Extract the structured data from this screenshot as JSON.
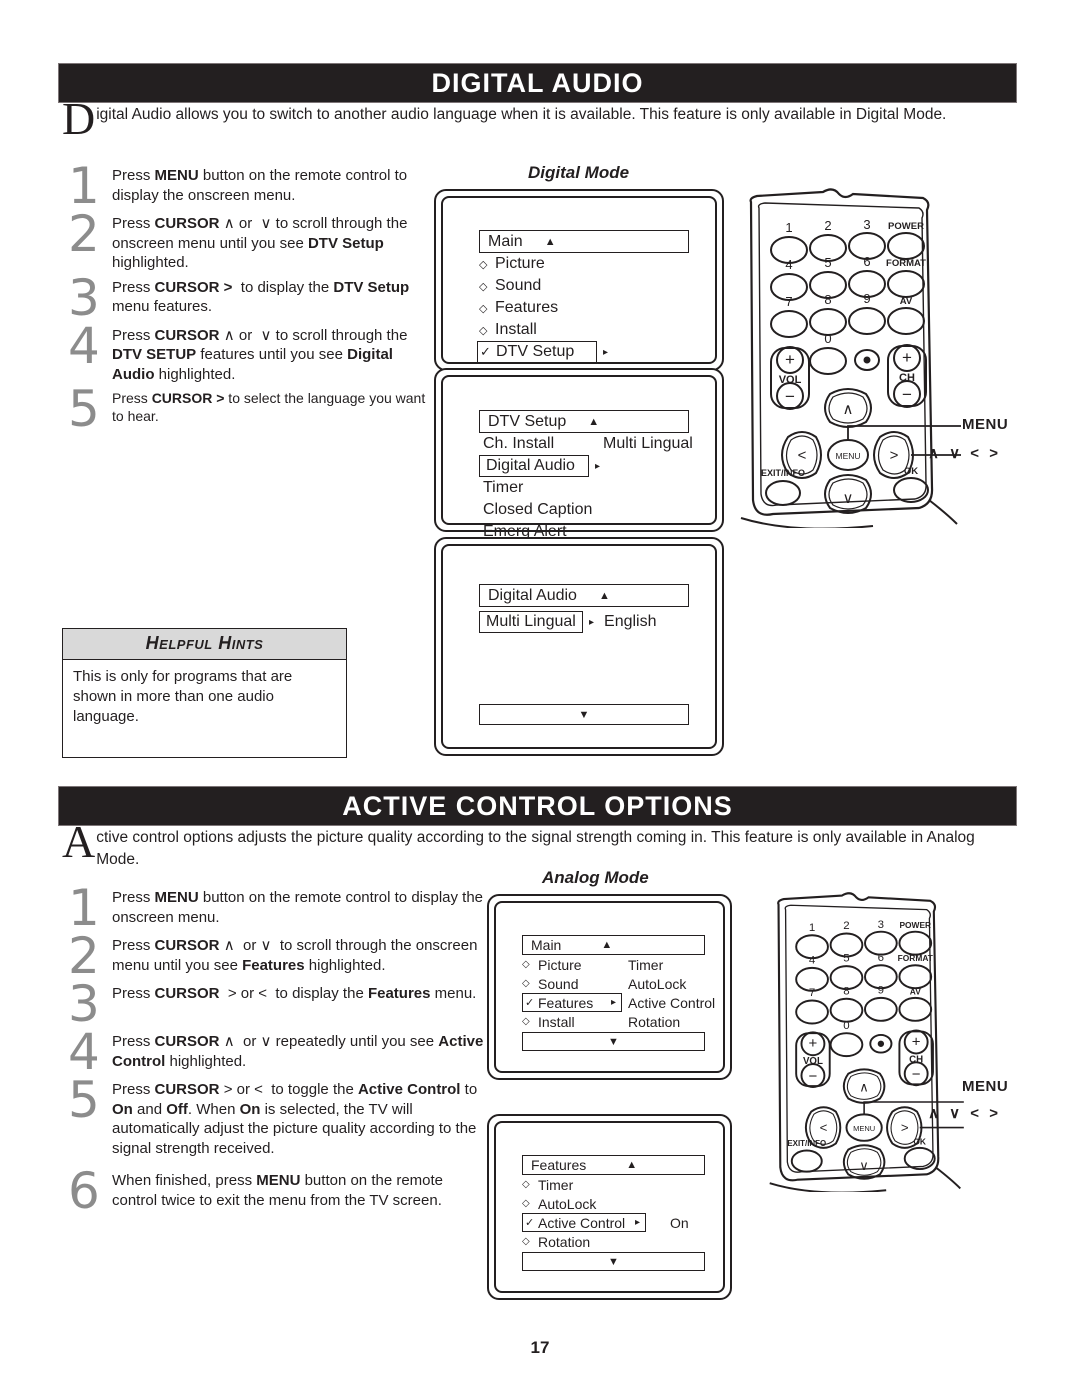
{
  "page": {
    "number": "17"
  },
  "sections": [
    {
      "id": "digital-audio",
      "title": "DIGITAL AUDIO",
      "intro_dropcap": "D",
      "intro_text": "igital Audio allows you to switch to another audio language when it is available. This feature is only available in Digital Mode.",
      "mode_label": "Digital Mode",
      "steps": [
        {
          "num": "1",
          "html": "Press <b>MENU</b> button on the remote control to display the onscreen menu."
        },
        {
          "num": "2",
          "html": "Press <b>CURSOR</b> &#8743; or &nbsp;&#8744; to scroll through the onscreen menu until you see <b>DTV Setup</b> highlighted."
        },
        {
          "num": "3",
          "html": "Press <b>CURSOR &gt;</b> &nbsp;to display the <b>DTV Setup</b> menu features."
        },
        {
          "num": "4",
          "html": "Press <b>CURSOR</b> &#8743; or &nbsp;&#8744; to scroll through the <b>DTV SETUP</b> features until you see <b>Digital Audio</b> highlighted."
        },
        {
          "num": "5",
          "html": "Press <b>CURSOR &gt;</b> to select the language you want to hear."
        }
      ],
      "hints": {
        "title": "Helpful Hints",
        "body": "This is only for programs that are shown in more than one audio language."
      }
    },
    {
      "id": "active-control-options",
      "title": "ACTIVE CONTROL OPTIONS",
      "intro_dropcap": "A",
      "intro_text": "ctive control options adjusts the picture quality according to the signal strength coming in.  This feature is only available in Analog Mode.",
      "mode_label": "Analog Mode",
      "steps": [
        {
          "num": "1",
          "html": "Press <b>MENU</b> button on the remote control to display the onscreen menu."
        },
        {
          "num": "2",
          "html": "Press <b>CURSOR</b> &#8743; &nbsp;or &#8744; &nbsp;to scroll through the onscreen menu until you see <b>Features</b> highlighted."
        },
        {
          "num": "3",
          "html": "Press <b>CURSOR</b> &nbsp;&gt; or &lt; &nbsp;to display the <b>Features</b> menu."
        },
        {
          "num": "4",
          "html": "Press <b>CURSOR</b> &#8743; &nbsp;or &#8744; repeatedly until you see <b>Active Control</b> highlighted."
        },
        {
          "num": "5",
          "html": "Press <b>CURSOR</b> &gt; or &lt; &nbsp;to toggle the <b>Active Control</b> to <b>On</b> and <b>Off</b>.  When <b>On</b> is selected, the TV will automatically adjust the picture quality according to the signal strength received."
        },
        {
          "num": "6",
          "html": "When finished, press <b>MENU</b> button on the remote control twice to exit the menu from the TV screen."
        }
      ]
    }
  ],
  "osd_screens": {
    "digital_main": {
      "title": "Main",
      "caret": "▲",
      "rows": [
        {
          "marker": "◇",
          "label": "Picture",
          "selected": false
        },
        {
          "marker": "◇",
          "label": "Sound",
          "selected": false
        },
        {
          "marker": "◇",
          "label": "Features",
          "selected": false
        },
        {
          "marker": "◇",
          "label": "Install",
          "selected": false
        },
        {
          "marker": "✓",
          "label": "DTV Setup",
          "selected": true,
          "arrow": "▸"
        }
      ]
    },
    "dtv_setup": {
      "title": "DTV Setup",
      "caret": "▲",
      "rows": [
        {
          "marker": "",
          "label": "Ch. Install",
          "selected": false
        },
        {
          "marker": "",
          "label": "Digital Audio",
          "selected": true,
          "arrow": "▸"
        },
        {
          "marker": "",
          "label": "Timer",
          "selected": false
        },
        {
          "marker": "",
          "label": "Closed Caption",
          "selected": false
        },
        {
          "marker": "",
          "label": "Emerg Alert",
          "selected": false
        }
      ],
      "side_value": "Multi Lingual"
    },
    "digital_audio": {
      "title": "Digital Audio",
      "caret": "▲",
      "rows": [
        {
          "marker": "",
          "label": "Multi Lingual",
          "selected": true,
          "arrow": "▸"
        }
      ],
      "side_value": "English",
      "footer_caret": "▼"
    },
    "analog_main": {
      "title": "Main",
      "caret": "▲",
      "rows": [
        {
          "marker": "◇",
          "label": "Picture",
          "selected": false
        },
        {
          "marker": "◇",
          "label": "Sound",
          "selected": false
        },
        {
          "marker": "✓",
          "label": "Features",
          "selected": true,
          "arrow": "▸"
        },
        {
          "marker": "◇",
          "label": "Install",
          "selected": false
        }
      ],
      "submenu": [
        "Timer",
        "AutoLock",
        "Active Control",
        "Rotation"
      ],
      "footer_caret": "▼"
    },
    "analog_features": {
      "title": "Features",
      "caret": "▲",
      "rows": [
        {
          "marker": "◇",
          "label": "Timer",
          "selected": false
        },
        {
          "marker": "◇",
          "label": "AutoLock",
          "selected": false
        },
        {
          "marker": "✓",
          "label": "Active Control",
          "selected": true,
          "arrow": "▸"
        },
        {
          "marker": "◇",
          "label": "Rotation",
          "selected": false
        }
      ],
      "side_value": "On",
      "footer_caret": "▼"
    }
  },
  "remote": {
    "keys_row1": [
      "1",
      "2",
      "3"
    ],
    "keys_row2": [
      "4",
      "5",
      "6"
    ],
    "keys_row3": [
      "7",
      "8",
      "9"
    ],
    "key_zero": "0",
    "key_dot": "·",
    "side_keys": [
      "POWER",
      "FORMAT",
      "AV"
    ],
    "vol_label": "VOL",
    "ch_label": "CH",
    "plus": "+",
    "minus": "−",
    "menu_label": "MENU",
    "exit_label": "EXIT/INFO",
    "ok_label": "OK",
    "up": "∧",
    "down": "∨",
    "left": "‹",
    "right": "›",
    "callout_menu": "MENU",
    "callout_cursor": "∧ ∨ < >"
  },
  "colors": {
    "bar_bg": "#231f20",
    "bar_text": "#ffffff",
    "step_number": "#8c8c8c",
    "hint_title_bg": "#d9d9d9",
    "ink": "#231f20"
  }
}
